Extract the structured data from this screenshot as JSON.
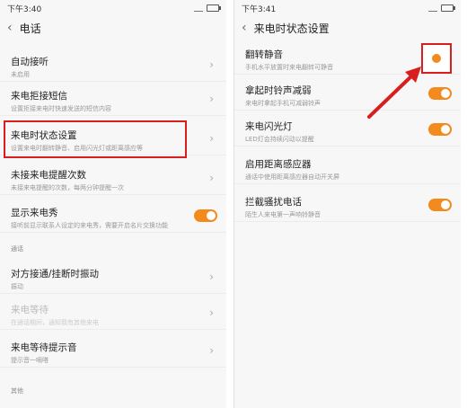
{
  "left": {
    "status": {
      "time": "下午3:40"
    },
    "title": "电话",
    "rows": [
      {
        "label": "自动接听",
        "desc": "未启用",
        "control": "chevron"
      },
      {
        "label": "来电拒接短信",
        "desc": "设置拒接来电时快速发送的短信内容",
        "control": "chevron"
      },
      {
        "label": "来电时状态设置",
        "desc": "设置来电时翻转静音、启用闪光灯或距离感应等",
        "control": "chevron"
      },
      {
        "label": "未接来电提醒次数",
        "desc": "未接来电提醒的次数，每两分钟提醒一次",
        "control": "chevron"
      },
      {
        "label": "显示来电秀",
        "desc": "接听前显示联系人设定的来电秀，需要开启名片交换功能",
        "control": "toggle"
      }
    ],
    "section_general": "通话",
    "rows2": [
      {
        "label": "对方接通/挂断时振动",
        "desc": "振动",
        "control": "chevron"
      },
      {
        "label": "来电等待",
        "desc": "在通话期间，通知我有其他来电",
        "control": "chevron",
        "disabled": true
      },
      {
        "label": "来电等待提示音",
        "desc": "提示音一嘀嗒",
        "control": "chevron"
      }
    ],
    "section_other": "其他"
  },
  "right": {
    "status": {
      "time": "下午3:41"
    },
    "title": "来电时状态设置",
    "rows": [
      {
        "label": "翻转静音",
        "desc": "手机水平放置时来电翻转可静音",
        "control": "toggle-highlight"
      },
      {
        "label": "拿起时铃声减弱",
        "desc": "来电时拿起手机可减弱铃声",
        "control": "toggle"
      },
      {
        "label": "来电闪光灯",
        "desc": "LED灯会持续闪动以提醒",
        "control": "toggle"
      },
      {
        "label": "启用距离感应器",
        "desc": "通话中使用距离感应器自动开关屏",
        "control": "none"
      },
      {
        "label": "拦截骚扰电话",
        "desc": "陌生人来电第一声响铃静音",
        "control": "toggle"
      }
    ]
  },
  "colors": {
    "accent": "#f28a1e",
    "highlight": "#d81e1e"
  }
}
